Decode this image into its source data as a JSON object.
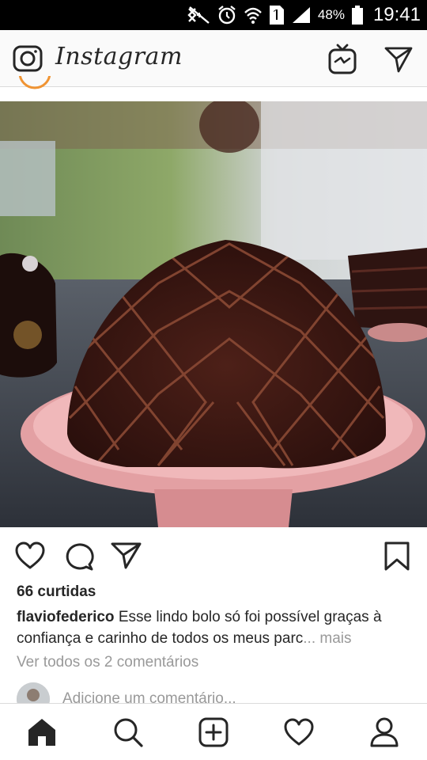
{
  "status_bar": {
    "icons": [
      "mute-icon",
      "alarm-icon",
      "wifi-icon",
      "sim-1-icon",
      "signal-icon",
      "battery-icon"
    ],
    "battery_percent": "48%",
    "time": "19:41"
  },
  "header": {
    "logo_text": "Instagram",
    "icons": [
      "camera-icon",
      "igtv-icon",
      "direct-message-icon"
    ]
  },
  "post": {
    "image_alt": "Bolo de chocolate sobre prato rosa",
    "actions": [
      "heart-icon",
      "comment-icon",
      "share-icon",
      "bookmark-icon"
    ],
    "likes": "66 curtidas",
    "caption_user": "flaviofederico",
    "caption_text": "Esse lindo bolo só foi possível graças à confiança e carinho de todos os meus parc",
    "caption_ellipsis": "...",
    "caption_more": "mais",
    "view_comments": "Ver todos os 2 comentários",
    "add_comment_placeholder": "Adicione um comentário..."
  },
  "bottom_nav": [
    "home-icon",
    "search-icon",
    "new-post-icon",
    "activity-icon",
    "profile-icon"
  ],
  "colors": {
    "text": "#262626",
    "muted": "#999999",
    "border": "#dbdbdb",
    "header_bg": "#fafafa",
    "avatar_ring": "#f09433"
  }
}
